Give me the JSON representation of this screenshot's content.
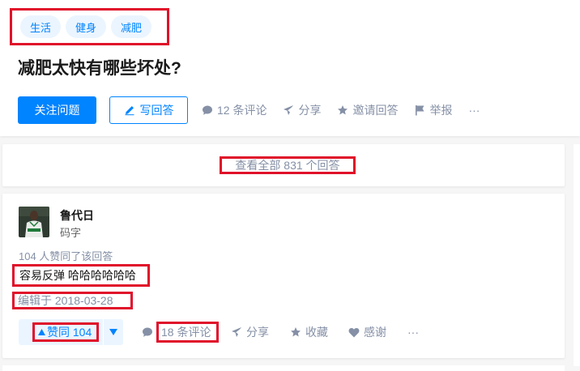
{
  "question": {
    "topics": [
      "生活",
      "健身",
      "减肥"
    ],
    "title": "减肥太快有哪些坏处?",
    "follow_label": "关注问题",
    "write_label": "写回答",
    "comments_label": "12 条评论",
    "share_label": "分享",
    "invite_label": "邀请回答",
    "report_label": "举报",
    "more_label": "···"
  },
  "view_all": {
    "label": "查看全部 831 个回答"
  },
  "answer": {
    "author": {
      "name": "鲁代日",
      "bio": "码字",
      "avatar_text": "RONDO"
    },
    "vote_info": "104 人赞同了该回答",
    "content": "容易反弹 哈哈哈哈哈哈",
    "edit_date": "编辑于 2018-03-28",
    "actions": {
      "upvote_label": "赞同 104",
      "comments_label": "18 条评论",
      "share_label": "分享",
      "collect_label": "收藏",
      "thanks_label": "感谢",
      "more_label": "···"
    }
  },
  "colors": {
    "brand": "#0084ff",
    "meta_gray": "#8590a6",
    "highlight_red": "#e0102a",
    "tag_bg": "#ebf5ff"
  }
}
